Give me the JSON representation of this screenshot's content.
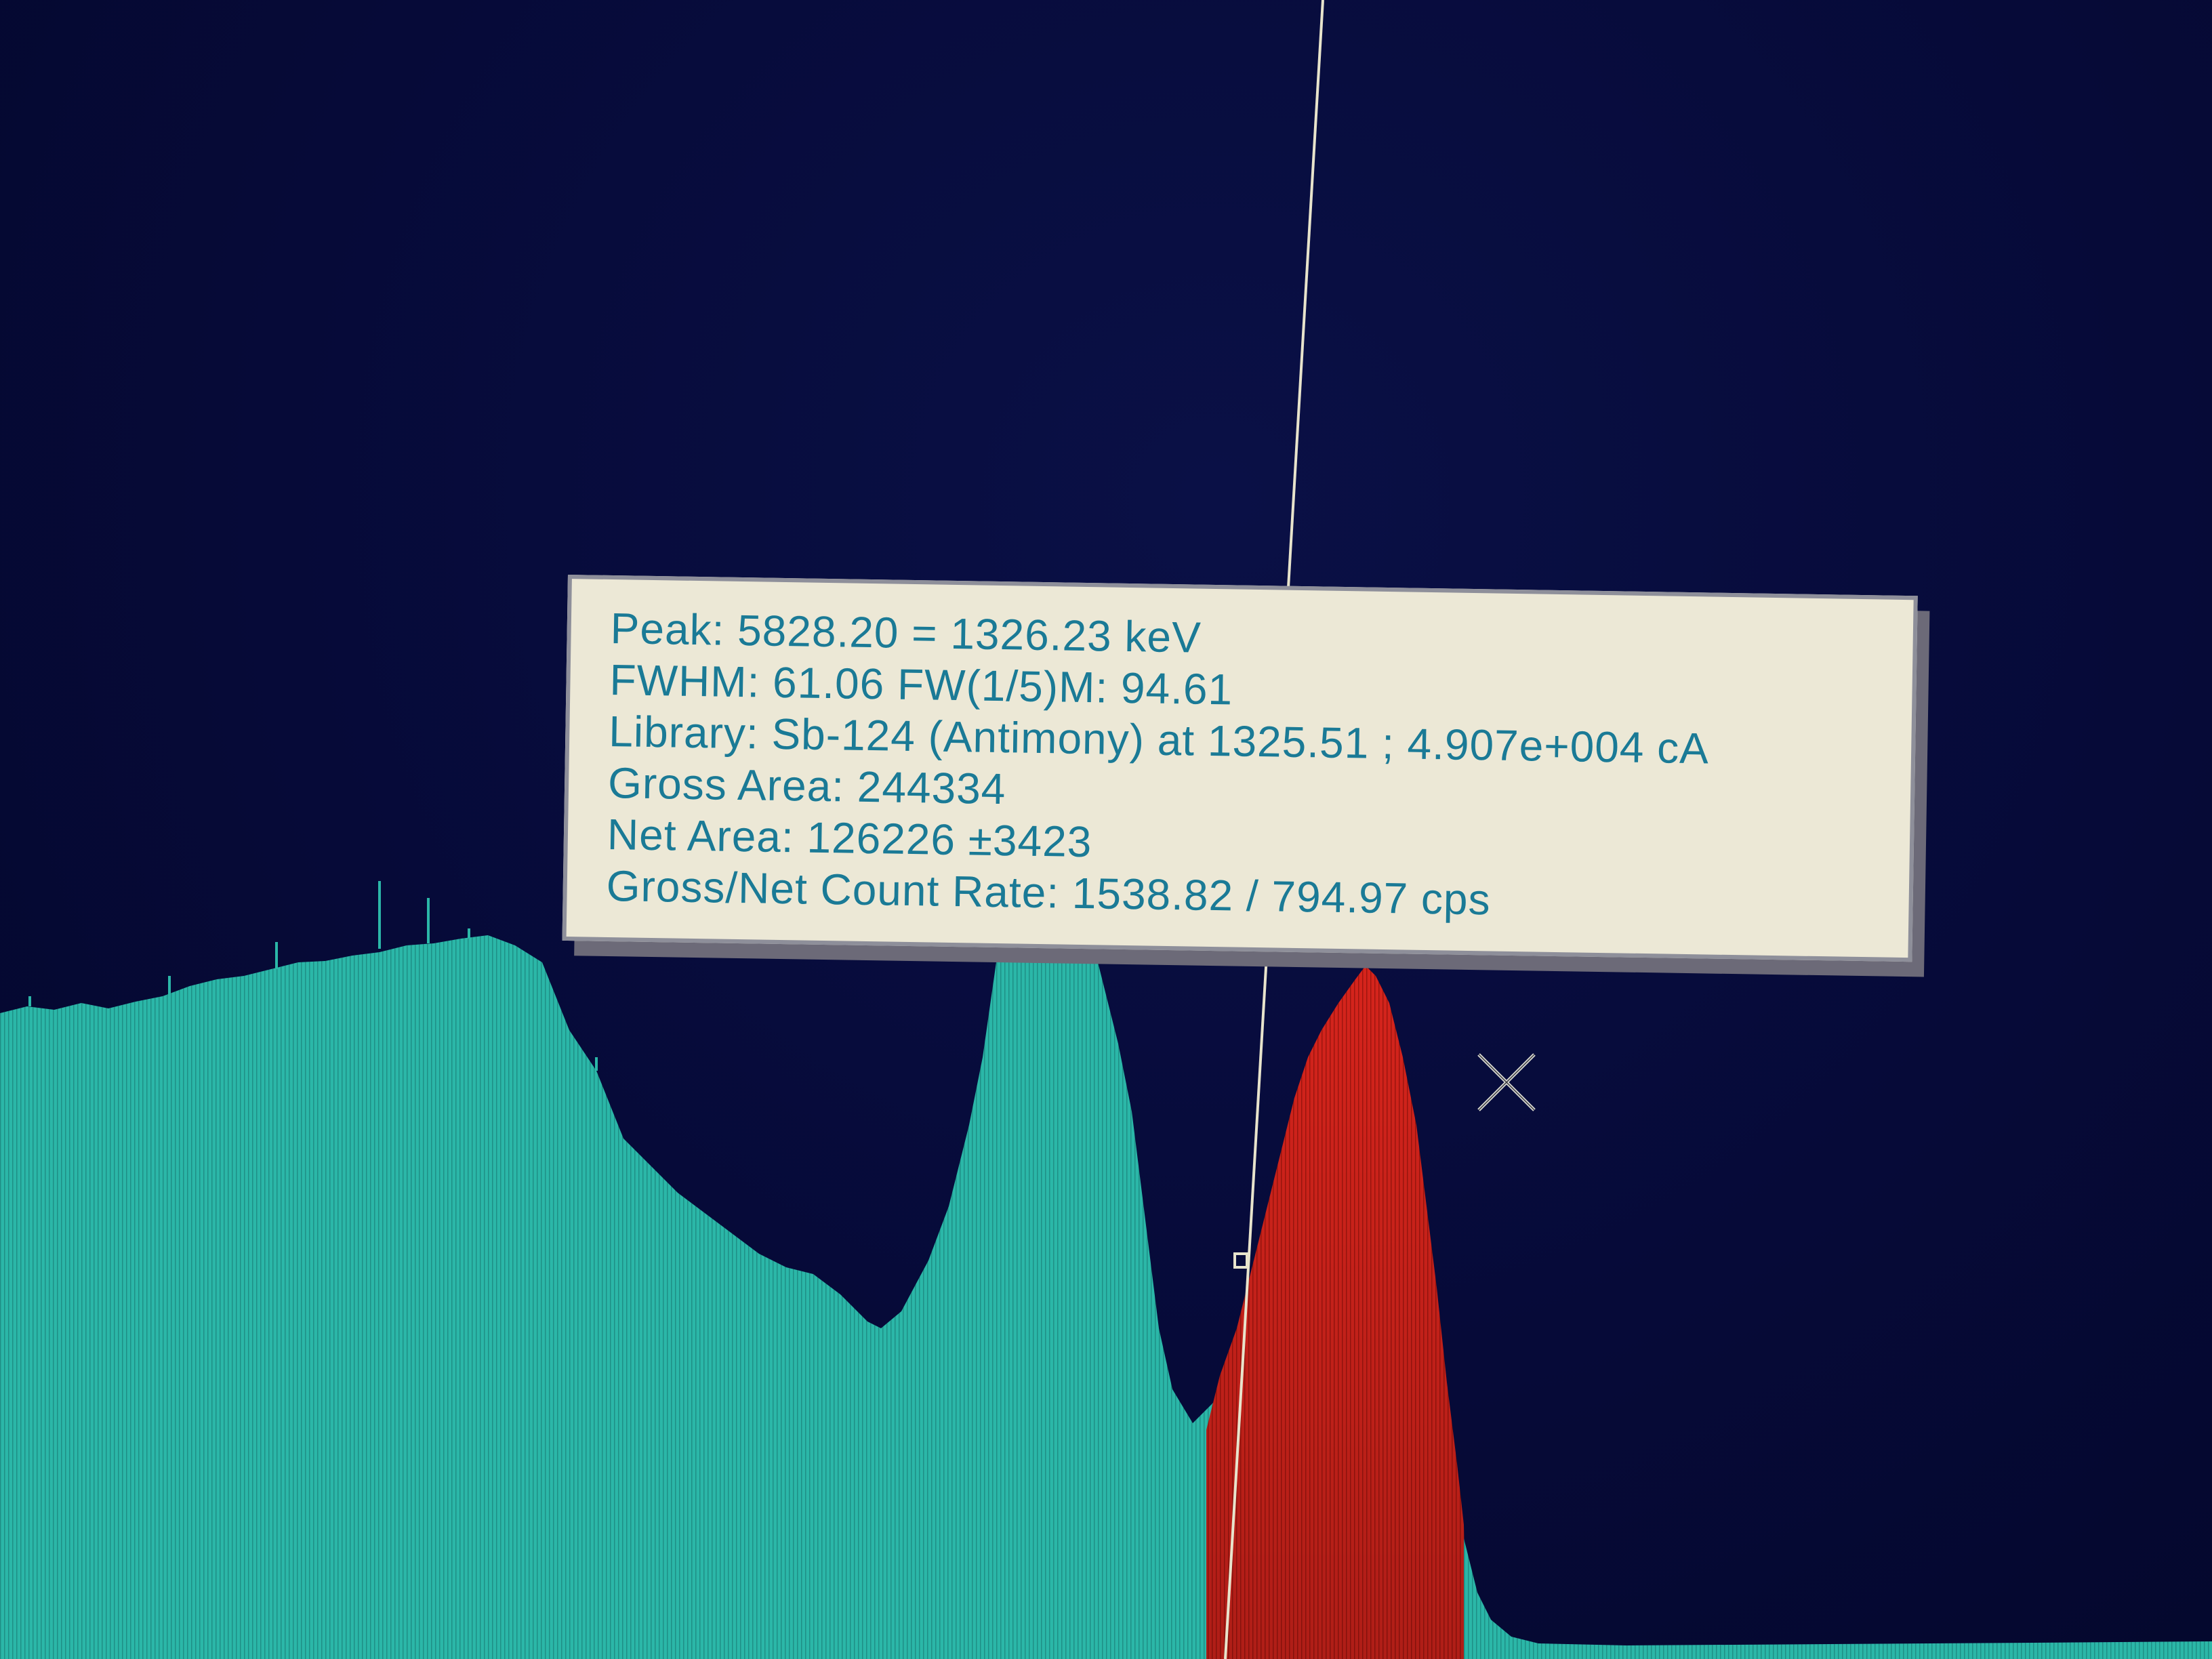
{
  "peak_info": {
    "peak": "Peak: 5828.20 = 1326.23 keV",
    "fwhm": "FWHM: 61.06  FW(1/5)M: 94.61",
    "library": "Library: Sb-124 (Antimony) at 1325.51 ;  4.907e+004 cA",
    "gross_area": "Gross Area: 244334",
    "net_area": "Net Area: 126226 ±3423",
    "count_rate": "Gross/Net Count Rate: 1538.82 / 794.97 cps"
  },
  "colors": {
    "background": "#060a38",
    "spectrum": "#2bb7a8",
    "roi_peak": "#d6241c",
    "tooltip_bg": "#ece8d6",
    "tooltip_text": "#1a7a96",
    "cursor_line": "#e8e4cc"
  },
  "icons": {
    "marker": "crosshair-x-icon",
    "cursor": "vertical-cursor-line"
  }
}
